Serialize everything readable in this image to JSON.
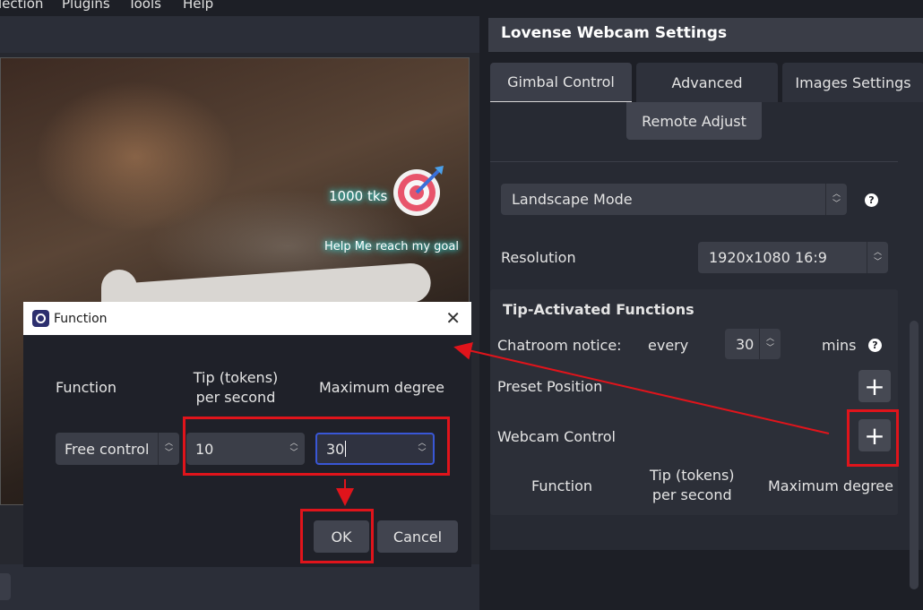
{
  "menu": {
    "items": [
      "lection",
      "Plugins",
      "Tools",
      "Help"
    ]
  },
  "preview": {
    "goal_amount": "1000 tks",
    "goal_message": "Help Me reach my goal"
  },
  "settings": {
    "title": "Lovense Webcam Settings",
    "tabs": [
      "Gimbal Control",
      "Advanced",
      "Images Settings"
    ],
    "active_tab": "Gimbal Control",
    "remote_adjust_label": "Remote Adjust",
    "mode_select": "Landscape Mode",
    "resolution_label": "Resolution",
    "resolution_value": "1920x1080 16:9",
    "tip_section": {
      "title": "Tip-Activated Functions",
      "notice_label": "Chatroom notice:",
      "notice_every": "every",
      "notice_value": "30",
      "notice_unit": "mins",
      "preset_label": "Preset Position",
      "webcam_label": "Webcam Control",
      "columns": [
        "Function",
        "Tip (tokens)\nper second",
        "Maximum degree"
      ]
    }
  },
  "dialog": {
    "title": "Function",
    "col_function": "Function",
    "col_tip": "Tip (tokens)\nper second",
    "col_max": "Maximum degree",
    "function_value": "Free control",
    "tip_value": "10",
    "max_value": "30",
    "ok_label": "OK",
    "cancel_label": "Cancel"
  },
  "colors": {
    "annotation": "#e0141b",
    "focus": "#3957d6",
    "glow": "#38f0f0"
  },
  "icons": [
    "target-icon",
    "help-icon",
    "plus-icon",
    "close-icon",
    "chevron-updown-icon"
  ]
}
